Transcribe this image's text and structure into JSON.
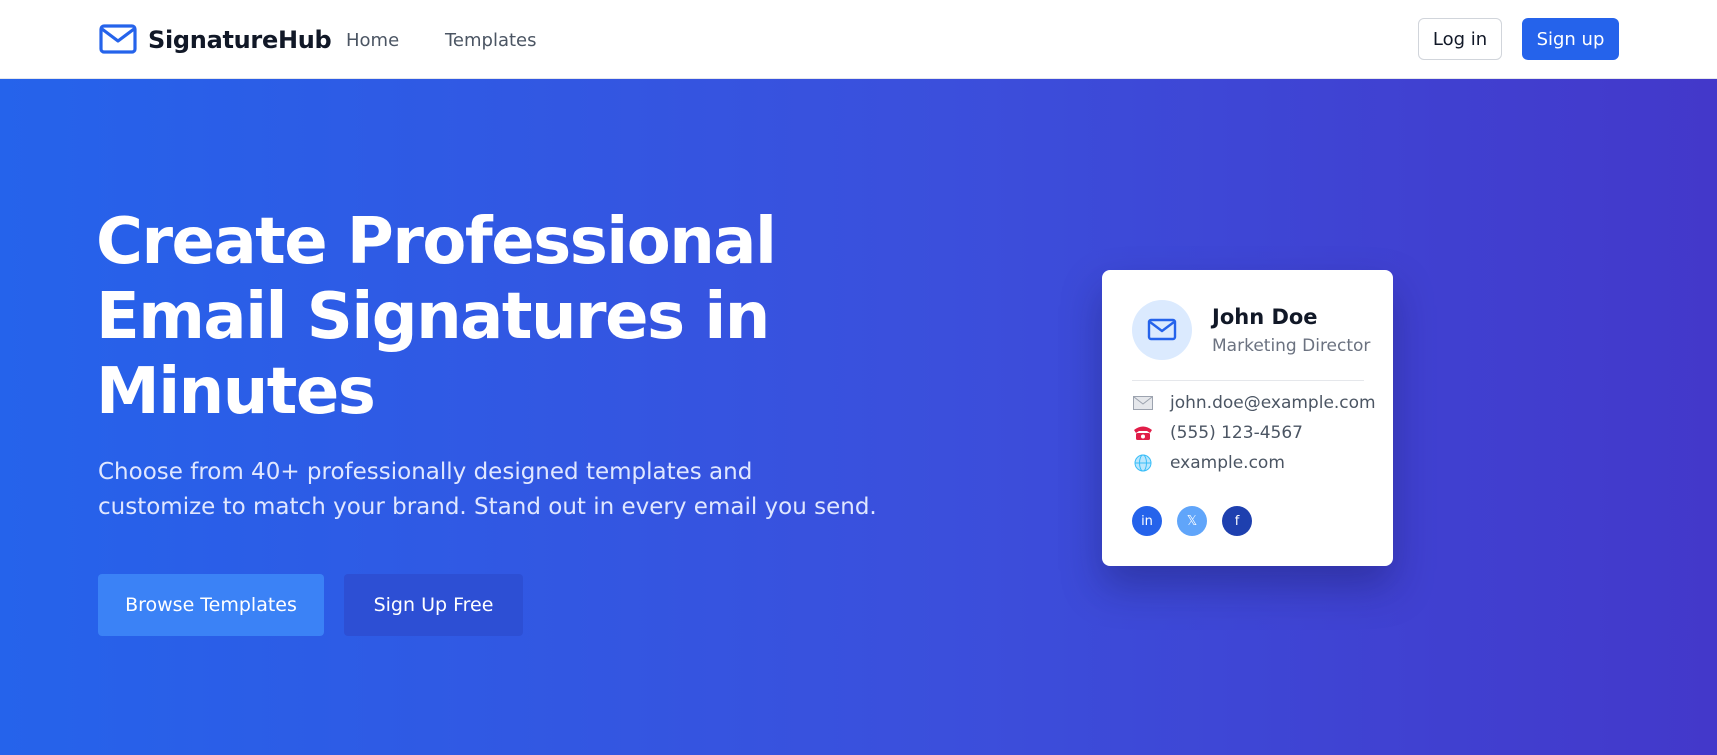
{
  "nav": {
    "brand": "SignatureHub",
    "links": [
      "Home",
      "Templates"
    ],
    "login_label": "Log in",
    "signup_label": "Sign up"
  },
  "hero": {
    "title_lines": [
      "Create Professional",
      "Email Signatures in",
      "Minutes"
    ],
    "subtitle_lines": [
      "Choose from 40+ professionally designed templates and",
      "customize to match your brand. Stand out in every email you send."
    ],
    "primary_cta": "Browse Templates",
    "secondary_cta": "Sign Up Free"
  },
  "signature_card": {
    "name": "John Doe",
    "role": "Marketing Director",
    "email": "john.doe@example.com",
    "phone": "(555) 123-4567",
    "website": "example.com",
    "icons": {
      "email": "envelope-icon",
      "phone": "telephone-icon",
      "website": "globe-icon"
    },
    "socials": [
      {
        "icon": "linkedin-icon",
        "glyph": "in"
      },
      {
        "icon": "x-icon",
        "glyph": "𝕏"
      },
      {
        "icon": "facebook-icon",
        "glyph": "f"
      }
    ]
  },
  "colors": {
    "accent": "#2563eb",
    "hero_gradient_start": "#2563eb",
    "hero_gradient_end": "#4338ca"
  }
}
